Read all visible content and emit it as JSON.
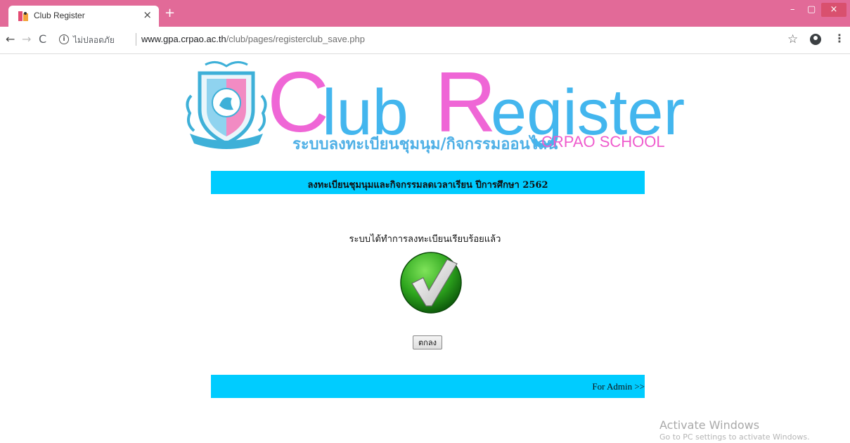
{
  "browser": {
    "tab_title": "Club Register",
    "tab_close": "×",
    "new_tab": "+",
    "window_controls": {
      "minimize": "–",
      "maximize": "▢",
      "close": "×"
    },
    "nav": {
      "back": "←",
      "forward": "→",
      "reload": "C"
    },
    "security_label": "ไม่ปลอดภัย",
    "url_host": "www.gpa.crpao.ac.th",
    "url_path": "/club/pages/registerclub_save.php",
    "bookmark_icon": "star-icon",
    "menu": "⋮",
    "accent_color": "#e26a98"
  },
  "logo": {
    "crest_text": "CRPAO SCHOOL",
    "title_c": "C",
    "title_lub": "lub",
    "title_r": "R",
    "title_egister": "egister",
    "thai_subtitle": "ระบบลงทะเบียนชุมนุม/กิจกรรมออนไลน์",
    "school": "CRPAO SCHOOL",
    "colors": {
      "pink": "#ef66d6",
      "blue": "#43b6ee"
    }
  },
  "header": {
    "text": "ลงทะเบียนชุมนุมและกิจกรรมลดเวลาเรียน ปีการศึกษา 2562",
    "bar_color": "#00ccff"
  },
  "main": {
    "success_message": "ระบบได้ทำการลงทะเบียนเรียบร้อยแล้ว",
    "success_icon": "check-circle-icon",
    "ok_button": "ตกลง"
  },
  "footer": {
    "admin_link": "For Admin >>"
  },
  "watermark": {
    "title": "Activate Windows",
    "subtitle": "Go to PC settings to activate Windows."
  }
}
